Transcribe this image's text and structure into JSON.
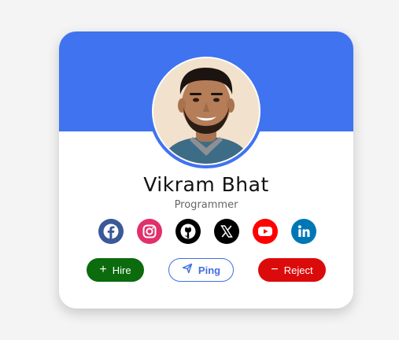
{
  "profile": {
    "name": "Vikram Bhat",
    "role": "Programmer",
    "banner_color": "#4073f0",
    "avatar_alt": "profile photo"
  },
  "socials": [
    {
      "name": "facebook-icon",
      "color": "#3b5998"
    },
    {
      "name": "instagram-icon",
      "color": "#e1306c"
    },
    {
      "name": "github-icon",
      "color": "#000000"
    },
    {
      "name": "x-icon",
      "color": "#000000"
    },
    {
      "name": "youtube-icon",
      "color": "#ff0000"
    },
    {
      "name": "linkedin-icon",
      "color": "#0077b5"
    }
  ],
  "actions": {
    "hire_label": "Hire",
    "ping_label": "Ping",
    "reject_label": "Reject",
    "hire_color": "#0b6b0d",
    "ping_color": "#3f6fe0",
    "reject_color": "#dc0b0b"
  }
}
